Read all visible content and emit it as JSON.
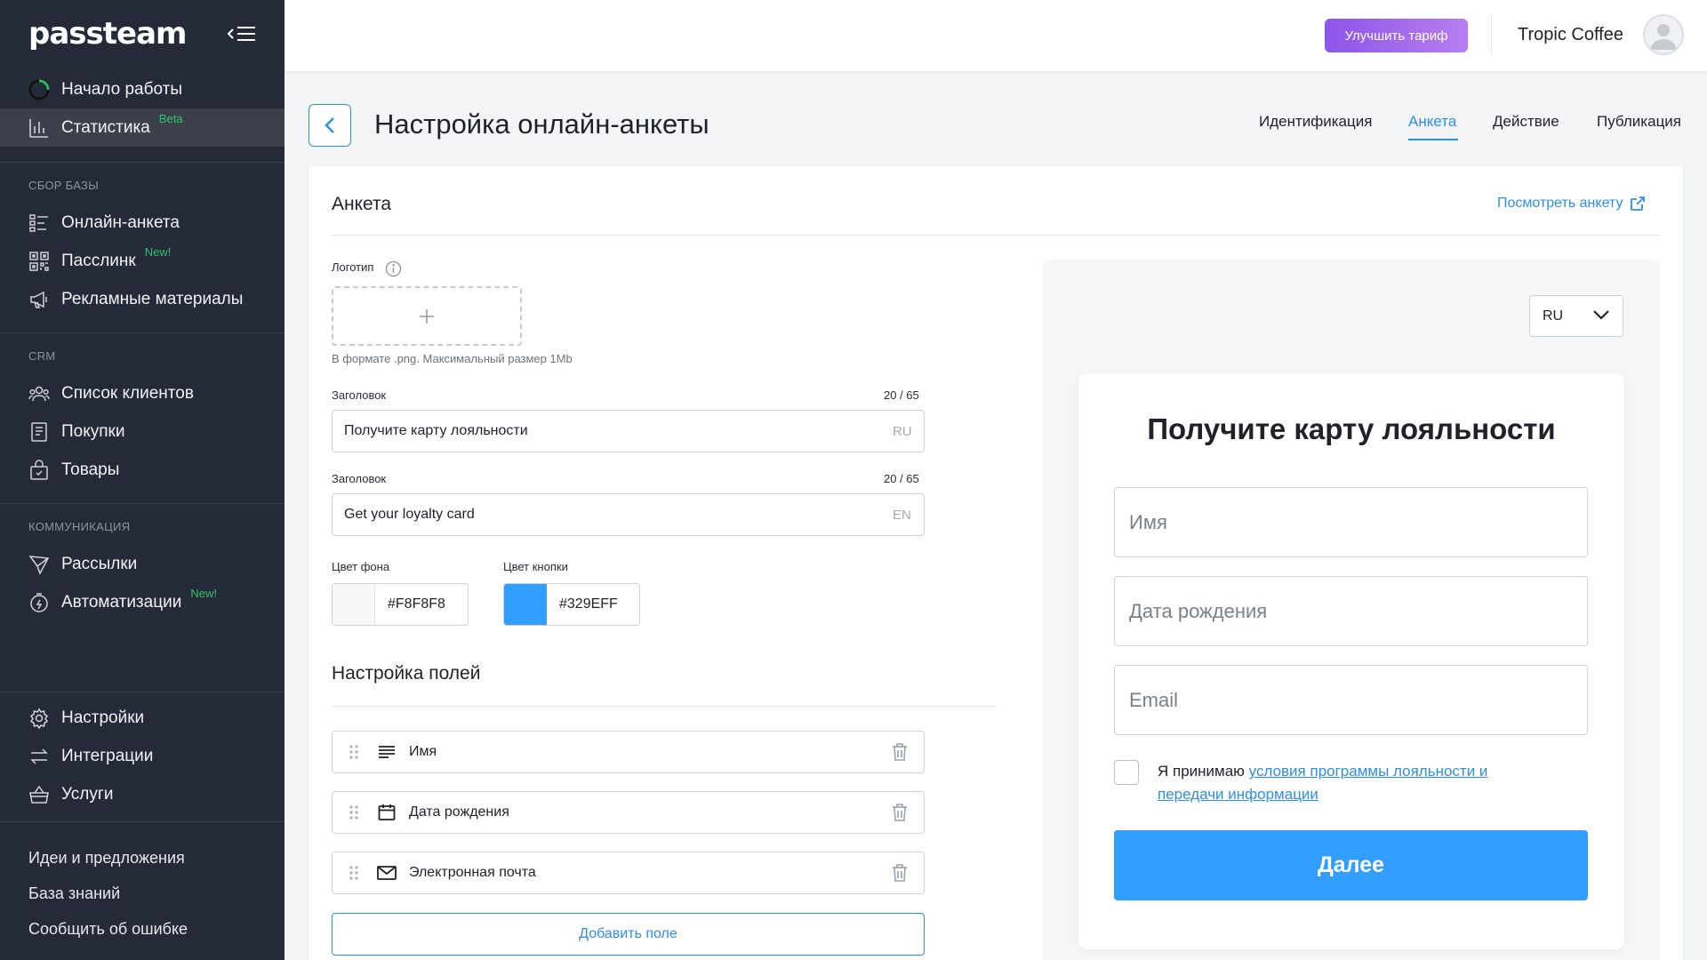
{
  "brand": {
    "logo_text": "passteam"
  },
  "sidebar": {
    "main_items": [
      {
        "label": "Начало работы",
        "icon": "progress-circle-icon"
      },
      {
        "label": "Статистика",
        "badge": "Beta",
        "icon": "bar-chart-icon",
        "active": true
      }
    ],
    "sections": [
      {
        "title": "СБОР БАЗЫ",
        "items": [
          {
            "label": "Онлайн-анкета",
            "icon": "form-list-icon"
          },
          {
            "label": "Пасслинк",
            "badge": "New!",
            "icon": "qr-code-icon"
          },
          {
            "label": "Рекламные материалы",
            "icon": "megaphone-icon"
          }
        ]
      },
      {
        "title": "CRM",
        "items": [
          {
            "label": "Список клиентов",
            "icon": "users-icon"
          },
          {
            "label": "Покупки",
            "icon": "receipt-icon"
          },
          {
            "label": "Товары",
            "icon": "shopping-bag-icon"
          }
        ]
      },
      {
        "title": "КОММУНИКАЦИЯ",
        "items": [
          {
            "label": "Рассылки",
            "icon": "send-icon"
          },
          {
            "label": "Автоматизации",
            "badge": "New!",
            "icon": "timer-icon"
          }
        ]
      }
    ],
    "bottom_items": [
      {
        "label": "Настройки",
        "icon": "gear-icon"
      },
      {
        "label": "Интеграции",
        "icon": "arrows-exchange-icon"
      },
      {
        "label": "Услуги",
        "icon": "basket-icon"
      }
    ],
    "footer_links": [
      "Идеи и предложения",
      "База знаний",
      "Сообщить об ошибке"
    ]
  },
  "topbar": {
    "upgrade_label": "Улучшить тариф",
    "company": "Tropic Coffee"
  },
  "page": {
    "title": "Настройка онлайн-анкеты",
    "tabs": [
      {
        "label": "Идентификация"
      },
      {
        "label": "Анкета",
        "active": true
      },
      {
        "label": "Действие"
      },
      {
        "label": "Публикация"
      }
    ]
  },
  "form": {
    "card_title": "Анкета",
    "view_link": "Посмотреть анкету",
    "logo_label": "Логотип",
    "logo_hint": "В формате .png. Максимальный размер 1Mb",
    "headings": [
      {
        "label": "Заголовок",
        "counter": "20 / 65",
        "value": "Получите карту лояльности",
        "lang": "RU"
      },
      {
        "label": "Заголовок",
        "counter": "20 / 65",
        "value": "Get your loyalty card",
        "lang": "EN"
      }
    ],
    "bg_color_label": "Цвет фона",
    "bg_color": "#F8F8F8",
    "button_color_label": "Цвет кнопки",
    "button_color": "#329EFF",
    "fields_section_title": "Настройка полей",
    "fields": [
      {
        "label": "Имя",
        "icon": "text-lines-icon"
      },
      {
        "label": "Дата рождения",
        "icon": "calendar-icon"
      },
      {
        "label": "Электронная почта",
        "icon": "envelope-icon"
      }
    ],
    "add_field_label": "Добавить поле"
  },
  "preview": {
    "language": "RU",
    "title": "Получите карту лояльности",
    "inputs": [
      "Имя",
      "Дата рождения",
      "Email"
    ],
    "consent_prefix": "Я принимаю ",
    "consent_link": "условия программы лояльности и передачи информации",
    "next_label": "Далее"
  },
  "colors": {
    "sidebar_bg": "#242A37",
    "accent": "#2C8FE6",
    "upgrade_gradient_start": "#8D55E8",
    "badge_green": "#32C36C"
  }
}
